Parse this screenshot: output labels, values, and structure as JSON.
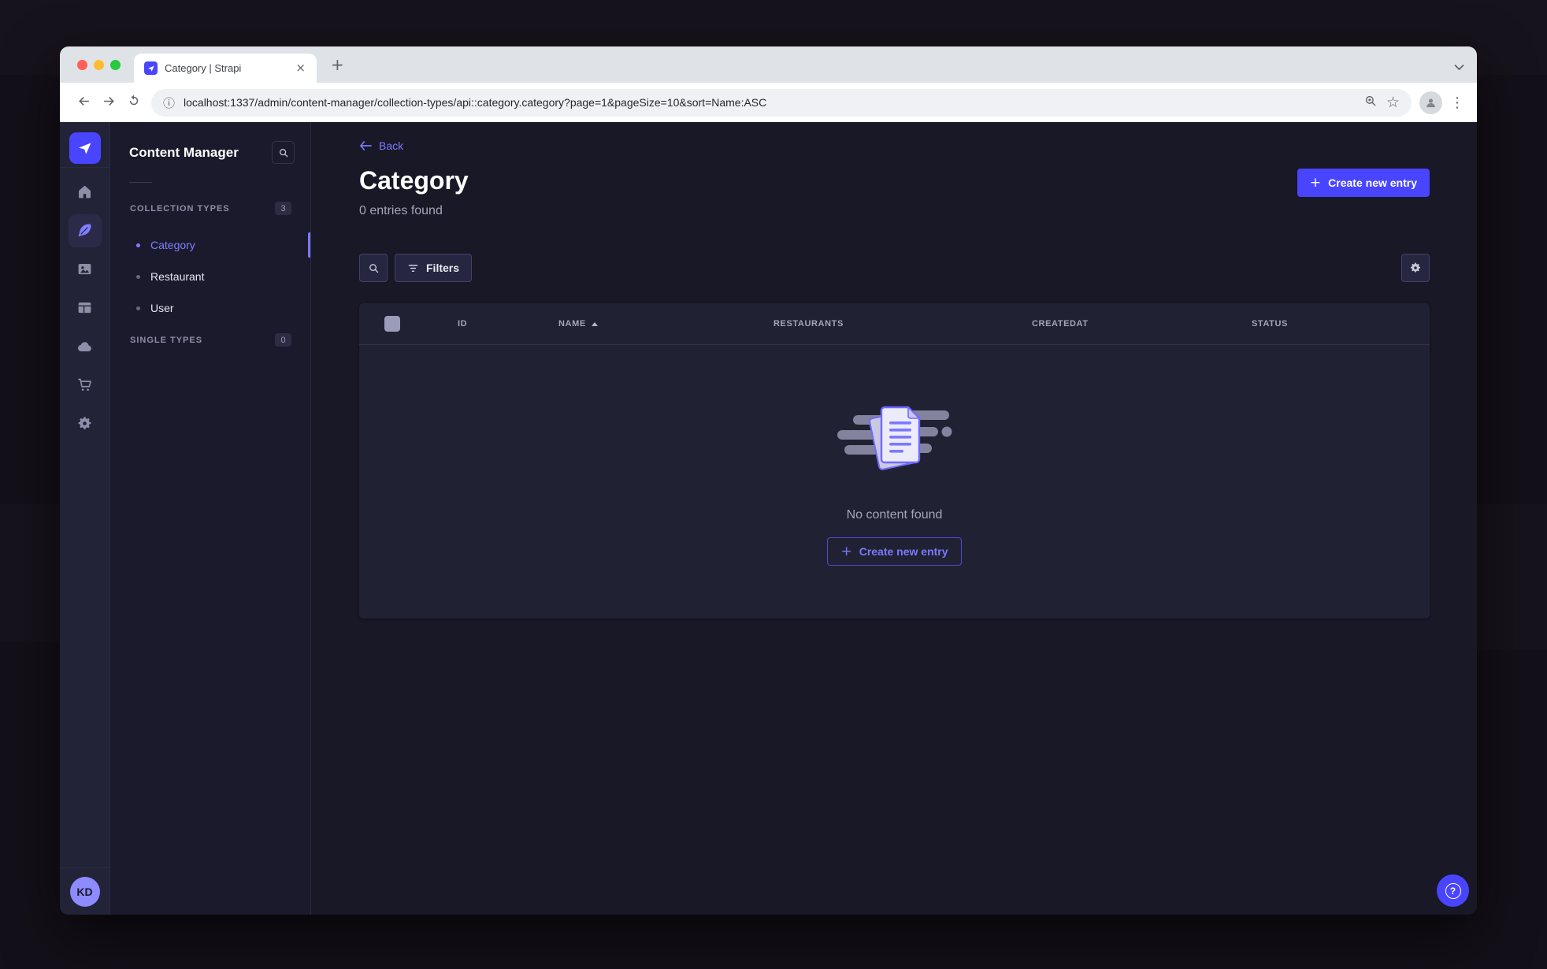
{
  "colors": {
    "primary": "#4945ff",
    "primary_light": "#7b79ff",
    "app_background": "#181826",
    "panel_background": "#212134",
    "traffic_red": "#ff5f57",
    "traffic_yellow": "#febc2e",
    "traffic_green": "#28c840"
  },
  "browser": {
    "tab_title": "Category | Strapi",
    "url": "localhost:1337/admin/content-manager/collection-types/api::category.category?page=1&pageSize=10&sort=Name:ASC"
  },
  "icons": {
    "close_tab": "×",
    "new_tab": "+",
    "menu_dots": "⋮",
    "star": "☆",
    "info": "ⓘ",
    "plus": "+",
    "help": "?"
  },
  "nav": {
    "avatar_initials": "KD"
  },
  "subnav": {
    "title": "Content Manager",
    "collection_types": {
      "label": "COLLECTION TYPES",
      "badge": "3",
      "items": [
        {
          "label": "Category",
          "active": true
        },
        {
          "label": "Restaurant",
          "active": false
        },
        {
          "label": "User",
          "active": false
        }
      ]
    },
    "single_types": {
      "label": "SINGLE TYPES",
      "badge": "0"
    }
  },
  "content": {
    "back_label": "Back",
    "title": "Category",
    "subtitle": "0 entries found",
    "create_button": "Create new entry",
    "filters_button": "Filters",
    "table": {
      "columns": [
        "ID",
        "NAME",
        "RESTAURANTS",
        "CREATEDAT",
        "STATUS"
      ],
      "sorted_column": "NAME",
      "sort_direction": "ASC",
      "empty_message": "No content found",
      "empty_create_button": "Create new entry"
    }
  }
}
